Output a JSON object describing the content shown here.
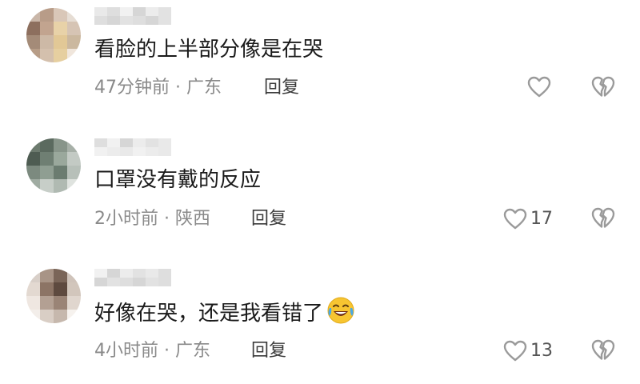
{
  "comments": [
    {
      "text": "看脸的上半部分像是在哭",
      "time": "47分钟前",
      "location": "广东",
      "reply_label": "回复",
      "likes": "",
      "avatar_colors": [
        "#c9b6a8",
        "#b89c88",
        "#d9c7b8",
        "#e6ddd4",
        "#8d6f5e",
        "#c2a48f",
        "#e8d2a8",
        "#d6c4b4",
        "#a48b78",
        "#cdb9a6",
        "#e2c896",
        "#cbb89f",
        "#b79d87",
        "#d4c0ad",
        "#e6cfa0",
        "#f0e6dc"
      ]
    },
    {
      "text": "口罩没有戴的反应",
      "time": "2小时前",
      "location": "陕西",
      "reply_label": "回复",
      "likes": "17",
      "avatar_colors": [
        "#6c7a6e",
        "#5b6a5f",
        "#88958a",
        "#a7b0a8",
        "#4e5c52",
        "#6f7f73",
        "#9aa89c",
        "#c3cac4",
        "#7c8a7f",
        "#8f9e92",
        "#6b7c70",
        "#b7c0b9",
        "#a0aca2",
        "#c7cec8",
        "#b0bab2",
        "#dfe3df"
      ]
    },
    {
      "text": "好像在哭，还是我看错了",
      "time": "4小时前",
      "location": "广东",
      "reply_label": "回复",
      "likes": "13",
      "avatar_colors": [
        "#d8cfc8",
        "#a89486",
        "#7a6558",
        "#cfc3ba",
        "#e3d9d1",
        "#8c7465",
        "#5e4a3f",
        "#d2c6bc",
        "#efe7e1",
        "#b3a093",
        "#9a8476",
        "#e0d6ce",
        "#f3eeea",
        "#d9cec5",
        "#c6b8ad",
        "#f6f2ee"
      ]
    }
  ],
  "separator": "·",
  "colors": {
    "text": "#1a1a1a",
    "meta": "#8a8a8a",
    "icon": "#9a9a9a"
  }
}
